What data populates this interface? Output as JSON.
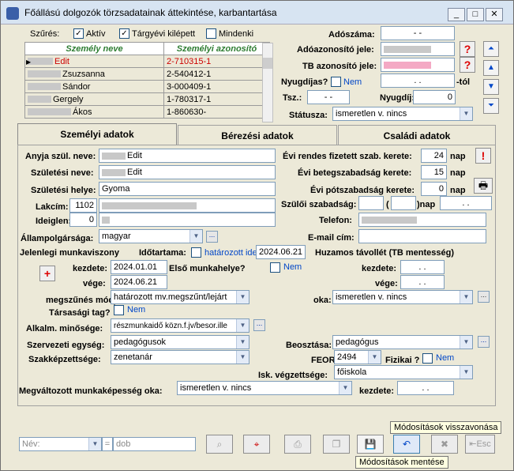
{
  "window": {
    "title": "Főállású dolgozók törzsadatainak áttekintése, karbantartása",
    "controls": [
      "minimize",
      "maximize",
      "close"
    ]
  },
  "filter": {
    "label": "Szűrés:",
    "options": [
      {
        "label": "Aktív",
        "checked": true
      },
      {
        "label": "Tárgyévi kilépett",
        "checked": true
      },
      {
        "label": "Mindenki",
        "checked": false
      }
    ]
  },
  "grid": {
    "columns": [
      "Személy neve",
      "Személyi azonosító"
    ],
    "rows": [
      {
        "name": "Edit",
        "id": "2-710315-1",
        "selected": true
      },
      {
        "name": "Zsuzsanna",
        "id": "2-540412-1"
      },
      {
        "name": "Sándor",
        "id": "3-000409-1"
      },
      {
        "name": "Gergely",
        "id": "1-780317-1"
      },
      {
        "name": "Ákos",
        "id": "1-860630-"
      }
    ]
  },
  "right_header": {
    "adoszama_label": "Adószáma:",
    "adoszama_value": "- -",
    "adoazonosito_label": "Adóazonosító jele:",
    "tb_label": "TB azonosító jele:",
    "nyugdijas_label": "Nyugdíjas?",
    "nyugdijas_value": "Nem",
    "tol_value": ". .",
    "tol_suffix": "-tól",
    "tsz_label": "Tsz.:",
    "tsz_value": "-  -",
    "nyugdij_label": "Nyugdíj:",
    "nyugdij_value": "0",
    "statusz_label": "Státusza:",
    "statusz_value": "ismeretlen v. nincs"
  },
  "tabs": [
    "Személyi adatok",
    "Bérezési adatok",
    "Családi adatok"
  ],
  "personal": {
    "anyja_label": "Anyja szül. neve:",
    "anyja_value": "Edit",
    "szul_nev_label": "Születési neve:",
    "szul_nev_value": "Edit",
    "szul_hely_label": "Születési helye:",
    "szul_hely_value": "Gyoma",
    "lakcim_label": "Lakcím:",
    "lakcim_zip": "1102",
    "ideigl_label": "Ideiglen:",
    "ideigl_zip": "0",
    "allampolgarsag_label": "Állampolgársága:",
    "allampolgarsag_value": "magyar",
    "evi_rendes_label": "Évi rendes fizetett szab. kerete:",
    "evi_rendes_value": "24",
    "evi_beteg_label": "Évi betegszabadság kerete:",
    "evi_beteg_value": "15",
    "evi_pot_label": "Évi pótszabadság kerete:",
    "evi_pot_value": "0",
    "nap": "nap",
    "szuloi_label": "Szülői szabadság:",
    "szuloi_open": "(",
    "szuloi_nap": ")nap",
    "szuloi_date": ". .",
    "telefon_label": "Telefon:",
    "email_label": "E-mail cím:",
    "jelenlegi_label": "Jelenlegi munkaviszony",
    "idotartama_label": "Időtartama:",
    "hatarozott_label": "határozott ideig:",
    "hatarozott_value": "2024.06.21",
    "kezdete_label": "kezdete:",
    "kezdete_value": "2024.01.01",
    "vege_label": "vége:",
    "vege_value": "2024.06.21",
    "elso_label": "Első munkahelye?",
    "elso_value": "Nem",
    "huzamos_label": "Huzamos távollét (TB mentesség)",
    "h_kezdete_label": "kezdete:",
    "h_kezdete_value": ". .",
    "h_vege_label": "vége:",
    "h_vege_value": ". .",
    "megszunes_label": "megszűnés módja:",
    "megszunes_value": "határozott mv.megszűnt/lejárt",
    "oka_label": "oka:",
    "oka_value": "ismeretlen v. nincs",
    "tarsasagi_label": "Társasági tag?",
    "tarsasagi_value": "Nem",
    "alkalm_label": "Alkalm. minősége:",
    "alkalm_value": "részmunkaidő közn.f.jv/besor.ille",
    "szervezeti_label": "Szervezeti egység:",
    "szervezeti_value": "pedagógusok",
    "beosztasa_label": "Beosztása:",
    "beosztasa_value": "pedagógus",
    "szakkepz_label": "Szakképzettsége:",
    "szakkepz_value": "zenetanár",
    "feor_label": "FEOR:",
    "feor_value": "2494",
    "fizikai_label": "Fizikai ?",
    "fizikai_value": "Nem",
    "isk_label": "Isk. végzettsége:",
    "isk_value": "főiskola",
    "megvaltozott_label": "Megváltozott munkaképesség oka:",
    "megvaltozott_value": "ismeretlen v. nincs",
    "m_kezdete_label": "kezdete:",
    "m_kezdete_value": ". ."
  },
  "bottom": {
    "search_field": "Név:",
    "operator": "=",
    "search_value": "dob",
    "tooltip_undo": "Módosítások visszavonása",
    "tooltip_save": "Módosítások mentése",
    "esc_label": "Esc"
  }
}
